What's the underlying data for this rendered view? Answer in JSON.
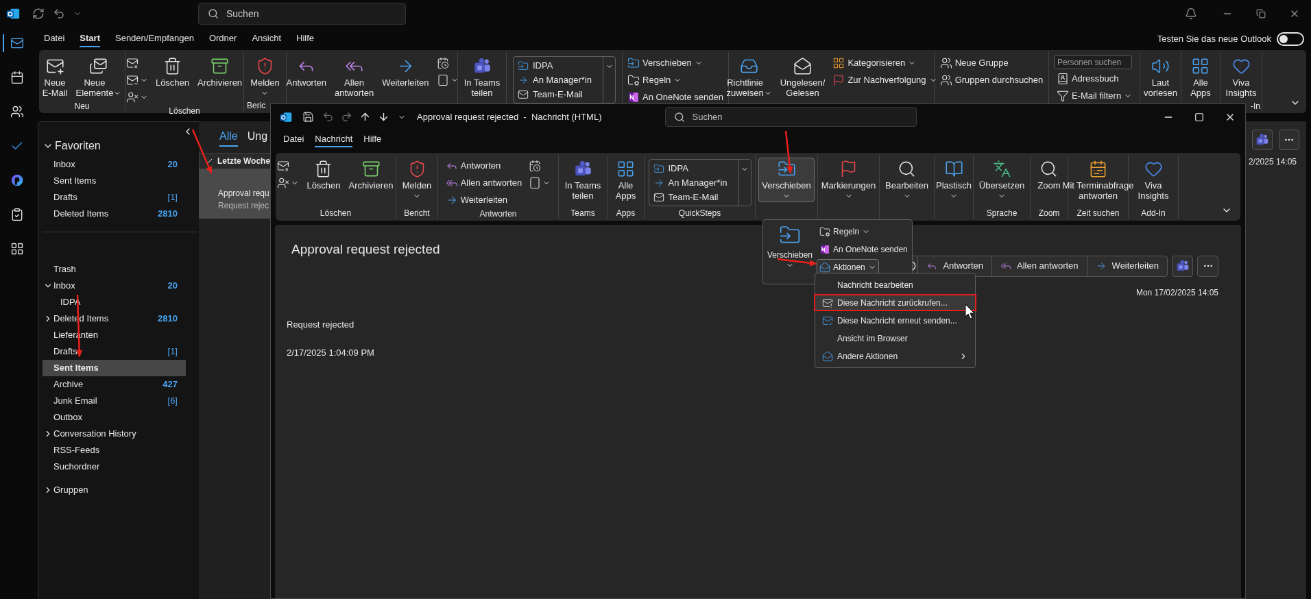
{
  "app": {
    "search": {
      "placeholder": "Suchen"
    },
    "rail": [
      {
        "selected": true
      },
      {
        "selected": false
      },
      {
        "selected": false
      },
      {
        "selected": false
      },
      {
        "selected": false
      },
      {
        "selected": false
      },
      {
        "selected": false
      }
    ],
    "menu_tabs": [
      {
        "label": "Datei",
        "selected": false
      },
      {
        "label": "Start",
        "selected": true
      },
      {
        "label": "Senden/Empfangen",
        "selected": false
      },
      {
        "label": "Ordner",
        "selected": false
      },
      {
        "label": "Ansicht",
        "selected": false
      },
      {
        "label": "Hilfe",
        "selected": false
      }
    ],
    "new_outlook": {
      "label": "Testen Sie das neue Outlook",
      "on": false
    },
    "ribbon": [
      {
        "label": "Neu",
        "items": [
          {
            "kind": "large",
            "label": "Neue\nE-Mail"
          },
          {
            "kind": "large",
            "label": "Neue\nElemente",
            "dropdown": true
          }
        ]
      },
      {
        "label": "Löschen",
        "items": [
          {
            "kind": "stack",
            "items": [
              {
                "kind": "icon",
                "dropdown": false
              },
              {
                "kind": "icon",
                "dropdown": true
              },
              {
                "kind": "icon",
                "dropdown": true
              }
            ]
          },
          {
            "kind": "large",
            "label": "Löschen"
          },
          {
            "kind": "large",
            "label": "Archivieren"
          }
        ]
      },
      {
        "label": "Beric",
        "items": [
          {
            "kind": "large",
            "label": "Melden",
            "dropdown": true
          }
        ]
      },
      {
        "items": [
          {
            "kind": "large",
            "label": "Antworten"
          },
          {
            "kind": "large",
            "label": "Allen\nantworten"
          },
          {
            "kind": "large",
            "label": "Weiterleiten"
          },
          {
            "kind": "stack",
            "items": [
              {
                "kind": "icon",
                "dropdown": false
              },
              {
                "kind": "icon",
                "dropdown": true
              }
            ]
          }
        ]
      },
      {
        "items": [
          {
            "kind": "large",
            "label": "In Teams\nteilen"
          }
        ]
      },
      {
        "items": [
          {
            "kind": "gallery",
            "items": [
              "IDPA",
              "An Manager*in",
              "Team-E-Mail"
            ]
          }
        ]
      },
      {
        "items": [
          {
            "kind": "stack",
            "items": [
              {
                "kind": "small",
                "label": "Verschieben",
                "dropdown": true
              },
              {
                "kind": "small",
                "label": "Regeln",
                "dropdown": true
              },
              {
                "kind": "small",
                "label": "An OneNote senden"
              }
            ]
          }
        ]
      },
      {
        "items": [
          {
            "kind": "large",
            "label": "Richtlinie\nzuweisen",
            "dropdown": true
          },
          {
            "kind": "large",
            "label": "Ungelesen/\nGelesen"
          },
          {
            "kind": "stack",
            "items": [
              {
                "kind": "small",
                "label": "Kategorisieren",
                "dropdown": true
              },
              {
                "kind": "small",
                "label": "Zur Nachverfolgung",
                "dropdown": true
              }
            ]
          }
        ]
      },
      {
        "items": [
          {
            "kind": "stack",
            "items": [
              {
                "kind": "small",
                "label": "Neue Gruppe"
              },
              {
                "kind": "small",
                "label": "Gruppen durchsuchen"
              }
            ]
          }
        ]
      },
      {
        "items": [
          {
            "kind": "stack",
            "items": [
              {
                "kind": "field",
                "placeholder": "Personen suchen"
              },
              {
                "kind": "small",
                "label": "Adressbuch"
              },
              {
                "kind": "small",
                "label": "E-Mail filtern",
                "dropdown": true
              }
            ]
          }
        ]
      },
      {
        "items": [
          {
            "kind": "large",
            "label": "Laut\nvorlesen"
          }
        ]
      },
      {
        "items": [
          {
            "kind": "large",
            "label": "Alle\nApps"
          }
        ]
      },
      {
        "label": "-In",
        "items": [
          {
            "kind": "large",
            "label": "Viva\nInsights"
          }
        ]
      }
    ],
    "folder_pane": {
      "favorites": {
        "title": "Favoriten",
        "expanded": true,
        "items": [
          {
            "label": "Inbox",
            "count": "20",
            "count_bold": true,
            "selected": false
          },
          {
            "label": "Sent Items",
            "selected": false
          },
          {
            "label": "Drafts",
            "count": "[1]",
            "count_bold": false,
            "selected": false
          },
          {
            "label": "Deleted Items",
            "count": "2810",
            "count_bold": true,
            "selected": false
          }
        ]
      },
      "folders": [
        {
          "label": "Trash",
          "selected": false
        },
        {
          "label": "Inbox",
          "count": "20",
          "count_bold": true,
          "expanded": true,
          "selected": false,
          "children": [
            {
              "label": "IDPA",
              "selected": false
            }
          ]
        },
        {
          "label": "Deleted Items",
          "count": "2810",
          "count_bold": true,
          "expanded": false,
          "selected": false
        },
        {
          "label": "Lieferanten",
          "selected": false
        },
        {
          "label": "Drafts",
          "count": "[1]",
          "count_bold": false,
          "selected": false
        },
        {
          "label": "Sent Items",
          "selected": true
        },
        {
          "label": "Archive",
          "count": "427",
          "count_bold": true,
          "selected": false
        },
        {
          "label": "Junk Email",
          "count": "[6]",
          "count_bold": false,
          "selected": false
        },
        {
          "label": "Outbox",
          "selected": false
        },
        {
          "label": "Conversation History",
          "expanded": false,
          "selected": false
        },
        {
          "label": "RSS-Feeds",
          "selected": false
        },
        {
          "label": "Suchordner",
          "selected": false
        }
      ],
      "groups": {
        "title": "Gruppen",
        "expanded": false
      }
    },
    "message_list": {
      "tabs": [
        {
          "label": "Alle",
          "selected": true
        },
        {
          "label": "Ung",
          "selected": false
        }
      ],
      "group_header": "Letzte Woche",
      "messages": [
        {
          "subject": "Approval requ",
          "preview": "Request rejec",
          "selected": true
        }
      ]
    },
    "reading_pane": {
      "date": "2/2025 14:05"
    }
  },
  "message_window": {
    "title": "Approval request rejected  -  Nachricht (HTML)",
    "search": {
      "placeholder": "Suchen"
    },
    "tabs": [
      {
        "label": "Datei",
        "selected": false
      },
      {
        "label": "Nachricht",
        "selected": true
      },
      {
        "label": "Hilfe",
        "selected": false
      }
    ],
    "ribbon": [
      {
        "label": "Löschen",
        "items": [
          {
            "kind": "stack",
            "items": [
              {
                "kind": "icon",
                "dropdown": false
              },
              {
                "kind": "icon",
                "dropdown": true
              }
            ]
          },
          {
            "kind": "large",
            "label": "Löschen"
          },
          {
            "kind": "large",
            "label": "Archivieren"
          }
        ]
      },
      {
        "label": "Bericht",
        "items": [
          {
            "kind": "large",
            "label": "Melden",
            "dropdown": true,
            "expanded": false
          }
        ]
      },
      {
        "label": "Antworten",
        "items": [
          {
            "kind": "stack",
            "items": [
              {
                "kind": "small",
                "label": "Antworten"
              },
              {
                "kind": "small",
                "label": "Allen antworten"
              },
              {
                "kind": "small",
                "label": "Weiterleiten"
              }
            ]
          },
          {
            "kind": "stack",
            "items": [
              {
                "kind": "icon",
                "dropdown": false
              },
              {
                "kind": "icon",
                "dropdown": true
              }
            ]
          }
        ]
      },
      {
        "label": "Teams",
        "items": [
          {
            "kind": "large",
            "label": "In Teams\nteilen"
          }
        ]
      },
      {
        "label": "Apps",
        "items": [
          {
            "kind": "large",
            "label": "Alle\nApps"
          }
        ]
      },
      {
        "label": "QuickSteps",
        "items": [
          {
            "kind": "gallery",
            "items": [
              "IDPA",
              "An Manager*in",
              "Team-E-Mail"
            ]
          }
        ]
      },
      {
        "items": [
          {
            "kind": "large",
            "label": "Verschieben",
            "dropdown": true,
            "expanded": true
          }
        ]
      },
      {
        "items": [
          {
            "kind": "large",
            "label": "Markierungen",
            "dropdown": true,
            "expanded": false
          }
        ]
      },
      {
        "items": [
          {
            "kind": "large",
            "label": "Bearbeiten",
            "dropdown": true,
            "expanded": false
          }
        ]
      },
      {
        "items": [
          {
            "kind": "large",
            "label": "Plastisch",
            "dropdown": true,
            "expanded": false
          }
        ]
      },
      {
        "label": "Sprache",
        "items": [
          {
            "kind": "large",
            "label": "Übersetzen",
            "dropdown": true,
            "expanded": false
          }
        ]
      },
      {
        "label": "Zoom",
        "items": [
          {
            "kind": "large",
            "label": "Zoom"
          }
        ]
      },
      {
        "label": "Zeit suchen",
        "items": [
          {
            "kind": "large",
            "label": "Mit Terminabfrage\nantworten"
          }
        ]
      },
      {
        "label": "Add-In",
        "items": [
          {
            "kind": "large",
            "label": "Viva\nInsights"
          }
        ]
      }
    ],
    "subject": "Approval request rejected",
    "actions": [
      "Antworten",
      "Allen antworten",
      "Weiterleiten"
    ],
    "date": "Mon 17/02/2025 14:05",
    "body": [
      "Request rejected",
      "2/17/2025 1:04:09 PM"
    ],
    "move_flyout": {
      "large": "Verschieben",
      "items": [
        {
          "label": "Regeln",
          "dropdown": true,
          "expanded": false
        },
        {
          "label": "An OneNote senden",
          "expanded": false
        },
        {
          "label": "Aktionen",
          "dropdown": true,
          "expanded": true
        }
      ]
    },
    "actions_menu": [
      {
        "label": "Nachricht bearbeiten",
        "selected": false,
        "submenu": false
      },
      {
        "label": "Diese Nachricht zurückrufen...",
        "selected": true,
        "submenu": false
      },
      {
        "label": "Diese Nachricht erneut senden...",
        "selected": false,
        "submenu": false
      },
      {
        "label": "Ansicht im Browser",
        "selected": false,
        "submenu": false
      },
      {
        "label": "Andere Aktionen",
        "selected": false,
        "submenu": true
      }
    ]
  }
}
